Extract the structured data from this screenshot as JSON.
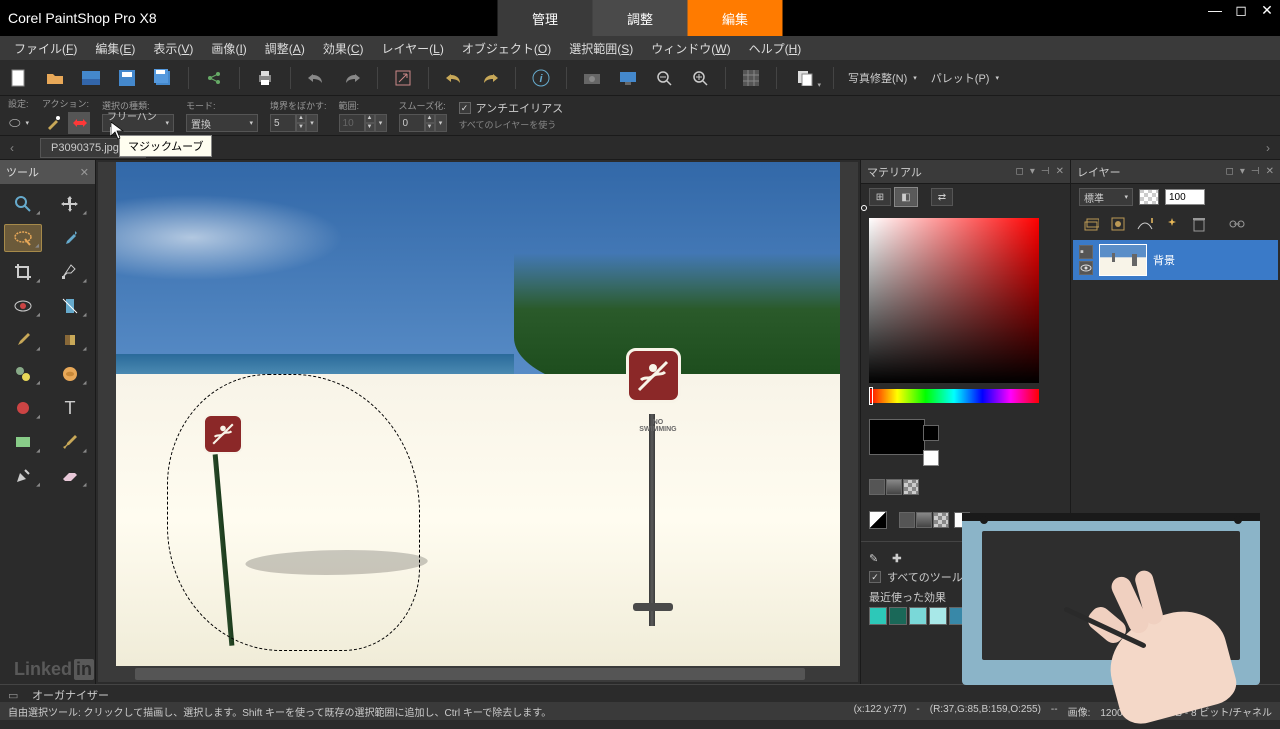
{
  "title": "Corel PaintShop Pro X8",
  "top_tabs": {
    "manage": "管理",
    "adjust": "調整",
    "edit": "編集"
  },
  "menu": [
    {
      "k": "file",
      "l": "ファイル",
      "u": "F"
    },
    {
      "k": "edit",
      "l": "編集",
      "u": "E"
    },
    {
      "k": "view",
      "l": "表示",
      "u": "V"
    },
    {
      "k": "image",
      "l": "画像",
      "u": "I"
    },
    {
      "k": "adjust",
      "l": "調整",
      "u": "A"
    },
    {
      "k": "effects",
      "l": "効果",
      "u": "C"
    },
    {
      "k": "layers",
      "l": "レイヤー",
      "u": "L"
    },
    {
      "k": "objects",
      "l": "オブジェクト",
      "u": "O"
    },
    {
      "k": "selections",
      "l": "選択範囲",
      "u": "S"
    },
    {
      "k": "window",
      "l": "ウィンドウ",
      "u": "W"
    },
    {
      "k": "help",
      "l": "ヘルプ",
      "u": "H"
    }
  ],
  "toolbar_text": {
    "photo_fix": "写真修整(N)",
    "palette": "パレット(P)"
  },
  "options": {
    "preset": "設定:",
    "action": "アクション:",
    "seltype": {
      "label": "選択の種類:",
      "value": "フリーハンド"
    },
    "mode": {
      "label": "モード:",
      "value": "置換"
    },
    "feather": {
      "label": "境界をぼかす:",
      "value": "5"
    },
    "range": {
      "label": "範囲:",
      "value": "10"
    },
    "smooth": {
      "label": "スムーズ化:",
      "value": "0"
    },
    "antialias": "アンチエイリアス",
    "all_layers": "すべてのレイヤーを使う"
  },
  "tooltip": "マジックムーブ",
  "file_tab": "P3090375.jpg",
  "tool_panel_title": "ツール",
  "no_swim": "NO\nSWIMMING",
  "materials": {
    "title": "マテリアル",
    "all_tools": "すべてのツール",
    "recent_effects": "最近使った効果"
  },
  "layers": {
    "title": "レイヤー",
    "blend": "標準",
    "opacity": "100",
    "bg_name": "背景"
  },
  "organizer": "オーガナイザー",
  "status": {
    "hint": "自由選択ツール: クリックして描画し、選択します。Shift キーを使って既存の選択範囲に追加し、Ctrl キーで除去します。",
    "coords": "(x:122 y:77)",
    "pixel": "(R:37,G:85,B:159,O:255)",
    "img_label": "画像:",
    "img_info": "1200 x 900 x RGB - 8 ビット/チャネル"
  },
  "linkedin": "Linked"
}
